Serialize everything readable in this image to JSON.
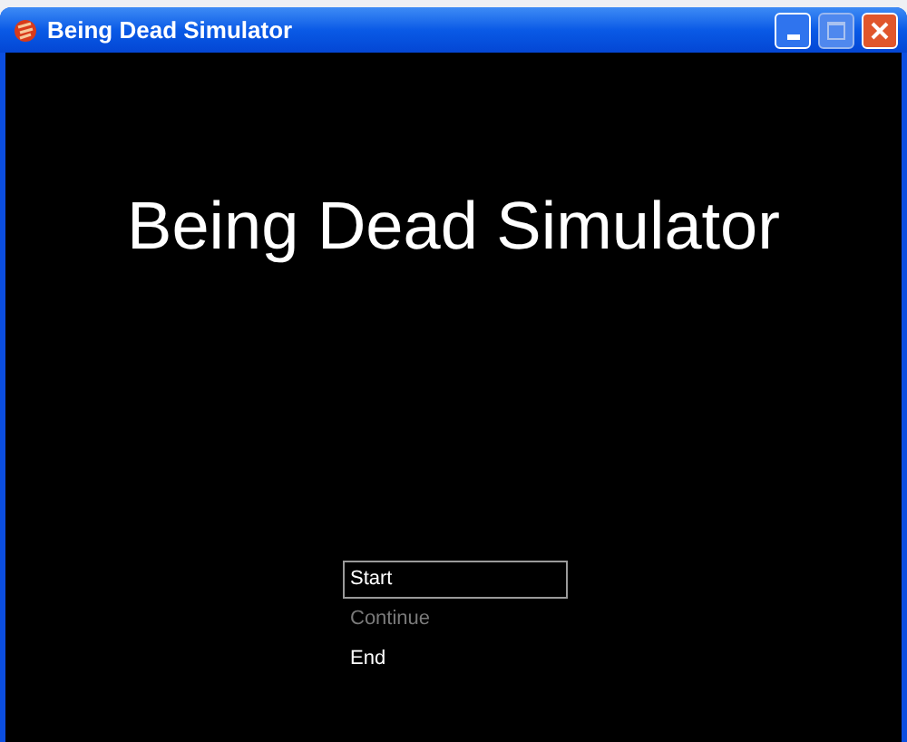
{
  "window": {
    "title": "Being Dead Simulator"
  },
  "game": {
    "title": "Being Dead Simulator"
  },
  "menu": [
    {
      "label": "Start",
      "selected": true,
      "disabled": false
    },
    {
      "label": "Continue",
      "selected": false,
      "disabled": true
    },
    {
      "label": "End",
      "selected": false,
      "disabled": false
    }
  ]
}
